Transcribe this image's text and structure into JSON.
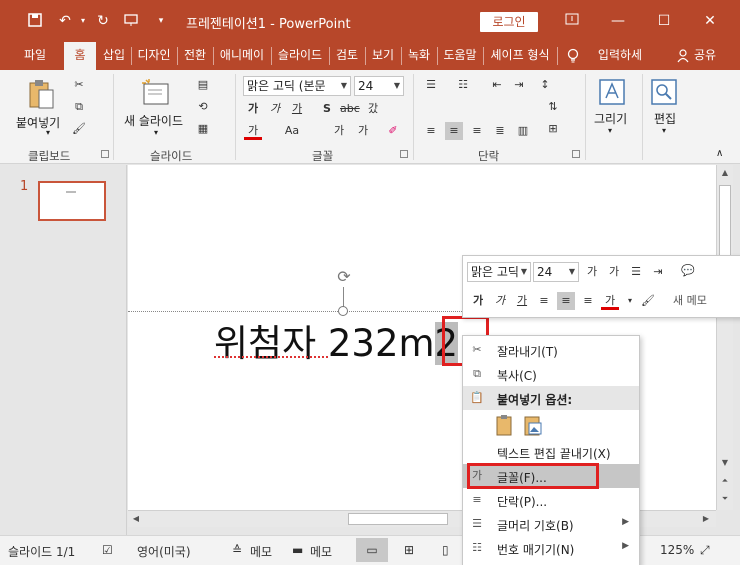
{
  "titlebar": {
    "title": "프레젠테이션1 - PowerPoint",
    "login_label": "로그인",
    "icons": [
      "save-icon",
      "undo-icon",
      "redo-icon",
      "start-slideshow-icon",
      "customize-qat-icon"
    ],
    "colors": {
      "brand": "#b7472a"
    }
  },
  "tabs": [
    {
      "label": "파일"
    },
    {
      "label": "홈"
    },
    {
      "label": "삽입"
    },
    {
      "label": "디자인"
    },
    {
      "label": "전환"
    },
    {
      "label": "애니메이"
    },
    {
      "label": "슬라이드"
    },
    {
      "label": "검토"
    },
    {
      "label": "보기"
    },
    {
      "label": "녹화"
    },
    {
      "label": "도움말"
    },
    {
      "label": "셰이프 형식"
    },
    {
      "label": "입력하세"
    },
    {
      "label": "공유"
    }
  ],
  "ribbon": {
    "paste_label": "붙여넣기",
    "new_slide_label": "새 슬라이드",
    "font_name": "맑은 고딕 (본문",
    "font_size": "24",
    "drawing_label": "그리기",
    "editing_label": "편집",
    "groups": {
      "clipboard": "클립보드",
      "slides": "슬라이드",
      "font": "글꼴",
      "paragraph": "단락"
    }
  },
  "thumbnails": {
    "slide_number": "1"
  },
  "slide": {
    "text_main": "위첨자 232m",
    "text_selected": "2"
  },
  "mini_toolbar": {
    "font_name": "맑은 고딕",
    "font_size": "24",
    "new_memo_label": "새 메모"
  },
  "context_menu": {
    "items": [
      {
        "label": "잘라내기(T)",
        "icon": "scissors-icon"
      },
      {
        "label": "복사(C)",
        "icon": "copy-icon"
      },
      {
        "label": "붙여넣기 옵션:",
        "icon": "paste-icon"
      },
      {
        "label": "",
        "icon": "paste-options-icon"
      },
      {
        "label": "텍스트 편집 끝내기(X)",
        "icon": ""
      },
      {
        "label": "글꼴(F)...",
        "icon": "font-icon"
      },
      {
        "label": "단락(P)...",
        "icon": "paragraph-icon"
      },
      {
        "label": "글머리 기호(B)",
        "icon": "bullets-icon"
      },
      {
        "label": "번호 매기기(N)",
        "icon": "numbering-icon"
      }
    ]
  },
  "statusbar": {
    "slide_info": "슬라이드 1/1",
    "language": "영어(미국)",
    "notes_label": "메모",
    "comments_label": "메모",
    "zoom": "125%"
  }
}
